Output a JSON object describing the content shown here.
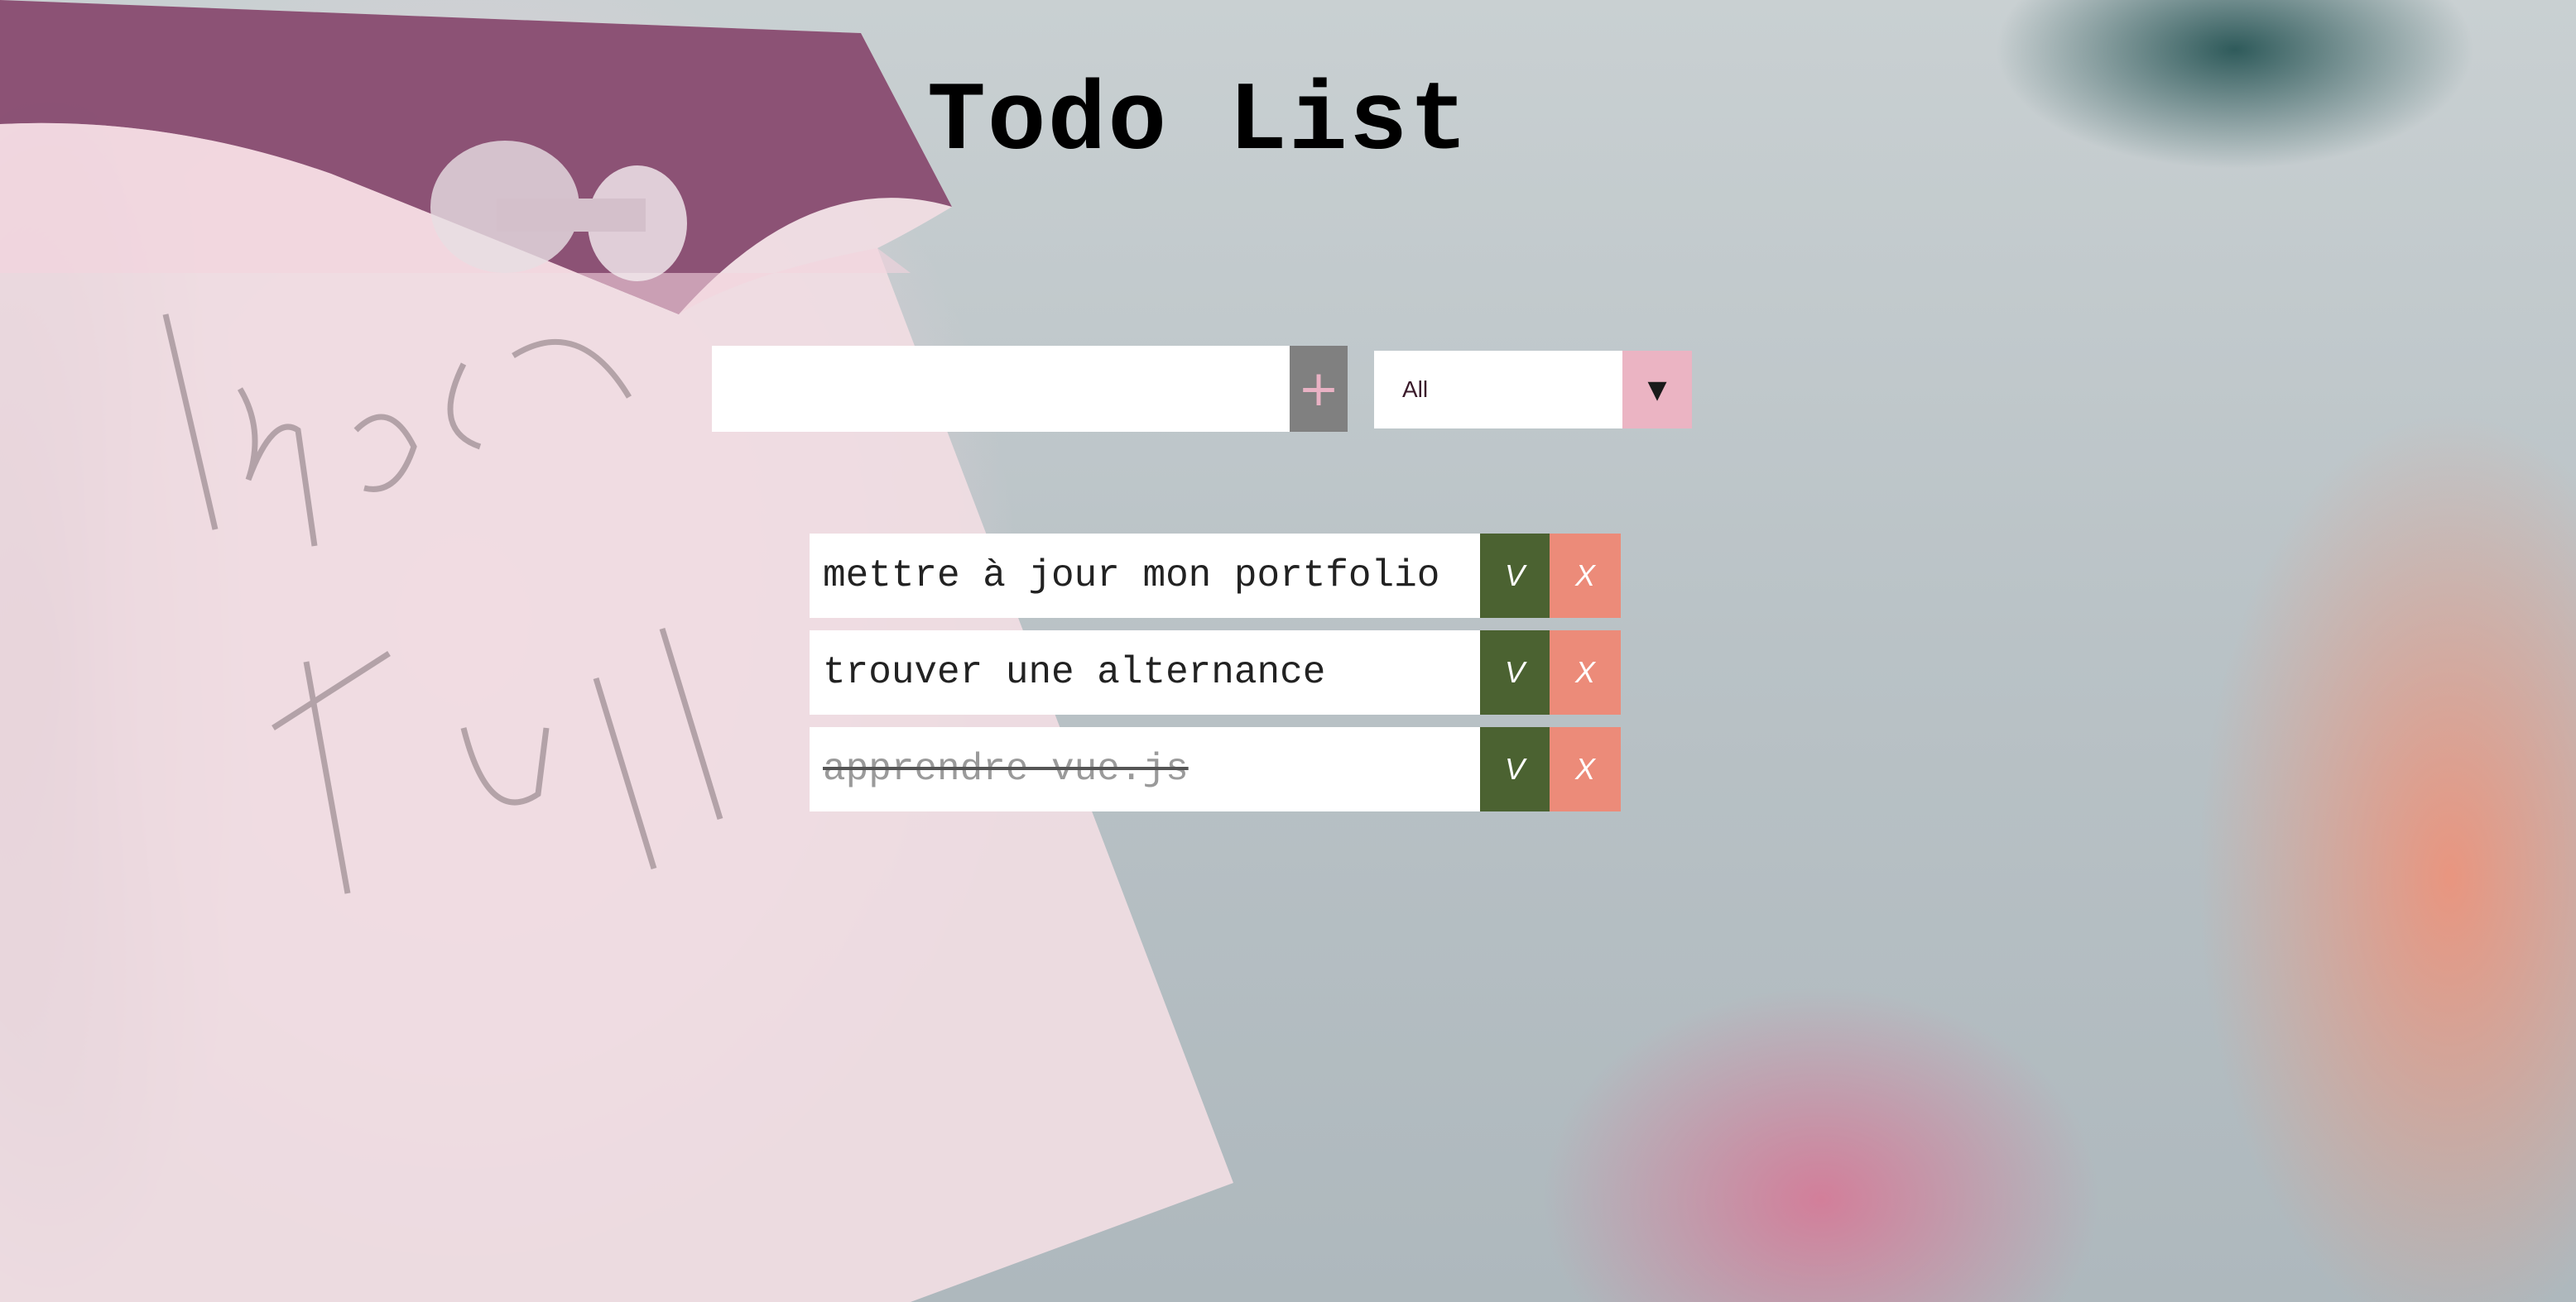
{
  "app": {
    "title": "Todo List"
  },
  "add_form": {
    "input_value": "",
    "add_button_icon": "plus-icon",
    "add_button_label": "+"
  },
  "filter": {
    "selected": "All",
    "arrow": "▼"
  },
  "todos": [
    {
      "text": "mettre à jour mon portfolio",
      "done": false,
      "check_label": "V",
      "delete_label": "X"
    },
    {
      "text": "trouver une alternance",
      "done": false,
      "check_label": "V",
      "delete_label": "X"
    },
    {
      "text": "apprendre vue.js",
      "done": true,
      "check_label": "V",
      "delete_label": "X"
    }
  ],
  "colors": {
    "add_button_bg": "#808080",
    "add_button_fg": "#e9b2c4",
    "filter_arrow_bg": "#ebb4c3",
    "check_button_bg": "#4b6231",
    "delete_button_bg": "#ec8b79",
    "done_text": "#9a9a9a"
  }
}
